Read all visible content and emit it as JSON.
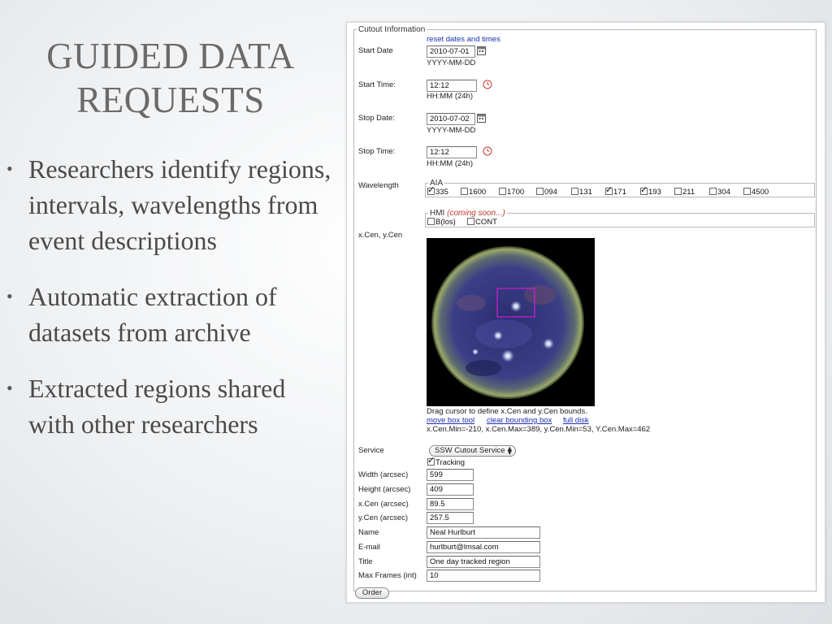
{
  "slide": {
    "title": "GUIDED DATA REQUESTS",
    "bullets": [
      "Researchers identify regions, intervals, wavelengths from event descriptions",
      "Automatic extraction of datasets from archive",
      "Extracted regions shared with other researchers"
    ]
  },
  "form": {
    "legend": "Cutout Information",
    "reset_link": "reset dates and times",
    "start_date": {
      "label": "Start Date",
      "value": "2010-07-01",
      "hint": "YYYY-MM-DD"
    },
    "start_time": {
      "label": "Start Time:",
      "value": "12:12",
      "hint": "HH:MM (24h)"
    },
    "stop_date": {
      "label": "Stop Date:",
      "value": "2010-07-02",
      "hint": "YYYY-MM-DD"
    },
    "stop_time": {
      "label": "Stop Time:",
      "value": "12:12",
      "hint": "HH:MM (24h)"
    },
    "wavelength": {
      "label": "Wavelength",
      "aia_legend": "AIA",
      "aia_channels": [
        {
          "label": "335",
          "checked": true
        },
        {
          "label": "1600",
          "checked": false
        },
        {
          "label": "1700",
          "checked": false
        },
        {
          "label": "094",
          "checked": false
        },
        {
          "label": "131",
          "checked": false
        },
        {
          "label": "171",
          "checked": true
        },
        {
          "label": "193",
          "checked": true
        },
        {
          "label": "211",
          "checked": false
        },
        {
          "label": "304",
          "checked": false
        },
        {
          "label": "4500",
          "checked": false
        }
      ],
      "hmi_legend": "HMI",
      "hmi_note": "(coming soon...)",
      "hmi_channels": [
        {
          "label": "B(los)",
          "checked": false
        },
        {
          "label": "CONT",
          "checked": false
        }
      ]
    },
    "xcen_label": "x.Cen, y.Cen",
    "drag_hint": "Drag cursor to define x.Cen and y.Cen bounds.",
    "bbox_links": [
      "move box tool",
      "clear bounding box",
      "full disk"
    ],
    "bounds_text": "x.Cen.Min=-210, x.Cen.Max=389, y.Cen.Min=53, Y.Cen.Max=462",
    "service": {
      "label": "Service",
      "value": "SSW Cutout Service"
    },
    "tracking": {
      "label": "Tracking",
      "checked": true
    },
    "fields": [
      {
        "label": "Width (arcsec)",
        "value": "599"
      },
      {
        "label": "Height (arcsec)",
        "value": "409"
      },
      {
        "label": "x.Cen (arcsec)",
        "value": "89.5"
      },
      {
        "label": "y.Cen (arcsec)",
        "value": "257.5"
      },
      {
        "label": "Name",
        "value": "Neal Hurlburt"
      },
      {
        "label": "E-mail",
        "value": "hurlburt@lmsal.com"
      },
      {
        "label": "Title",
        "value": "One day tracked region"
      },
      {
        "label": "Max Frames (int)",
        "value": "10"
      }
    ],
    "order_button": "Order"
  },
  "colors": {
    "title_text": "#6a6a6a",
    "body_text": "#4a4a4a",
    "link": "#1a2fb0",
    "hmi_note": "#c0392b",
    "selection_box": "#d21bd2"
  }
}
